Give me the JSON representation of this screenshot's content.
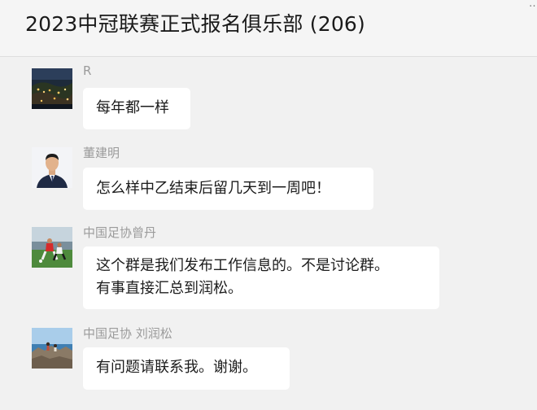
{
  "header": {
    "title": "2023中冠联赛正式报名俱乐部 (206)"
  },
  "messages": [
    {
      "sender": "R",
      "avatar": "night-city-photo",
      "lines": [
        "每年都一样"
      ]
    },
    {
      "sender": "董建明",
      "avatar": "man-in-suit-portrait",
      "lines": [
        "怎么样中乙结束后留几天到一周吧！"
      ]
    },
    {
      "sender": "中国足协曾丹",
      "avatar": "football-players-photo",
      "lines": [
        "这个群是我们发布工作信息的。不是讨论群。",
        "有事直接汇总到润松。"
      ]
    },
    {
      "sender": "中国足协 刘润松",
      "avatar": "seaside-rocks-photo",
      "lines": [
        "有问题请联系我。谢谢。"
      ]
    }
  ]
}
